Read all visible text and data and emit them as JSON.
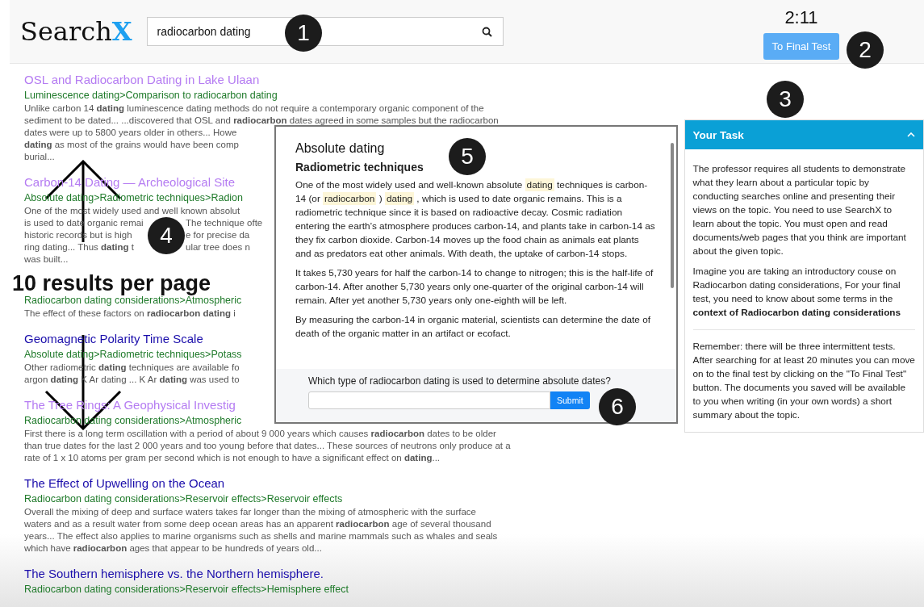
{
  "header": {
    "logo": {
      "text": "Search",
      "accent": "X"
    },
    "search": {
      "value": "radiocarbon dating"
    },
    "timer": "2:11",
    "final_button": "To Final Test"
  },
  "results": [
    {
      "title": "OSL and Radiocarbon Dating in Lake Ulaan",
      "visited": true,
      "breadcrumb": "Luminescence dating>Comparison to radiocarbon dating",
      "lines": [
        [
          "Unlike carbon 14 **dating** luminescence dating methods do not require a contemporary organic component of the"
        ],
        [
          "sediment to be dated... ...discovered that OSL and **radiocarbon** dates agreed in some samples but the radiocarbon"
        ],
        [
          "dates were up to 5800 years older in others... Howe"
        ],
        [
          "**dating** as most of the grains would have been comp"
        ],
        [
          "burial..."
        ]
      ]
    },
    {
      "title": "Carbon-14 Dating — Archeological Site",
      "visited": true,
      "breadcrumb": "Absolute dating>Radiometric techniques>Radion",
      "lines": [
        [
          "One of the most widely used and well known absolut"
        ],
        [
          "is used to date organic remai",
          "The technique ofte"
        ],
        [
          "historic records but is high",
          "e for precise da"
        ],
        [
          "ring dating... Thus **dating** t",
          "ular tree does n"
        ],
        [
          "was built..."
        ]
      ]
    },
    {
      "breadcrumb": "Radiocarbon dating considerations>Atmospheric",
      "lines": [
        [
          "The effect of these factors on **radiocarbon dating** i"
        ]
      ]
    },
    {
      "title": "Geomagnetic Polarity Time Scale",
      "visited": false,
      "breadcrumb": "Absolute dating>Radiometric techniques>Potass",
      "lines": [
        [
          "Other radiometric **dating** techniques are available fo"
        ],
        [
          "argon **dating** K Ar dating ... K Ar **dating** was used to"
        ]
      ]
    },
    {
      "title": "The Tree Rings: A Geophysical Investig",
      "visited": true,
      "breadcrumb": "Radiocarbon dating considerations>Atmospheric",
      "lines": [
        [
          "First there is a long term oscillation with a period of about 9 000 years which causes **radiocarbon** dates to be older"
        ],
        [
          "than true dates for the last 2 000 years and too young before that dates... These sources of neutrons only produce at a"
        ],
        [
          "rate of 1 x 10 atoms per gram per second which is not enough to have a significant effect on **dating**..."
        ]
      ]
    },
    {
      "title": "The Effect of Upwelling on the Ocean",
      "visited": false,
      "breadcrumb": "Radiocarbon dating considerations>Reservoir effects>Reservoir effects",
      "lines": [
        [
          "Overall the mixing of deep and surface waters takes far longer than the mixing of atmospheric with the surface"
        ],
        [
          "waters and as a result water from some deep ocean areas has an apparent **radiocarbon** age of several thousand"
        ],
        [
          "years... The effect also applies to marine organisms such as shells and marine mammals such as whales and seals"
        ],
        [
          "which have **radiocarbon** ages that appear to be hundreds of years old..."
        ]
      ]
    },
    {
      "title": "The Southern hemisphere vs. the Northern hemisphere.",
      "visited": false,
      "breadcrumb": "Radiocarbon dating considerations>Reservoir effects>Hemisphere effect"
    }
  ],
  "document_modal": {
    "title": "Absolute dating",
    "subtitle": "Radiometric techniques",
    "paragraphs": [
      [
        {
          "text": "One of the most widely used and well-known absolute",
          "highlight": false
        },
        {
          "text": "dating",
          "highlight": true
        },
        {
          "text": "techniques is carbon-14 (or",
          "highlight": false
        },
        {
          "text": "radiocarbon",
          "highlight": true
        },
        {
          "text": ")",
          "highlight": false
        },
        {
          "text": "dating",
          "highlight": true
        },
        {
          "text": ", which is used to date organic remains. This is a radiometric technique since it is based on radioactive decay. Cosmic radiation entering the earth’s atmosphere produces carbon-14, and plants take in carbon-14 as they fix carbon dioxide. Carbon-14 moves up the food chain as animals eat plants and as predators eat other animals. With death, the uptake of carbon-14 stops.",
          "highlight": false
        }
      ],
      [
        {
          "text": "It takes 5,730 years for half the carbon-14 to change to nitrogen; this is the half-life of carbon-14. After another 5,730 years only one-quarter of the original carbon-14 will remain. After yet another 5,730 years only one-eighth will be left.",
          "highlight": false
        }
      ],
      [
        {
          "text": "By measuring the carbon-14 in organic material, scientists can determine the date of death of the organic matter in an artifact or ecofact.",
          "highlight": false
        }
      ]
    ],
    "question": "Which type of radiocarbon dating is used to determine absolute dates?",
    "submit": "Submit"
  },
  "task_panel": {
    "title": "Your Task",
    "expanded": true,
    "paragraphs": [
      "The professor requires all students to demonstrate what they learn about a particular topic by conducting searches online and presenting their views on the topic. You need to use SearchX to learn about the topic. You must open and read documents/web pages that you think are important about the given topic.",
      "Imagine you are taking an introductory couse on Radiocarbon dating considerations, For your final test, you need to know about some terms in the **context of Radiocarbon dating considerations**"
    ],
    "reminder": "Remember: there will be three intermittent tests. After searching for at least 20 minutes you can move on to the final test by clicking on the \"To Final Test\" button. The documents you saved will be available to you when writing (in your own words) a short summary about the topic."
  },
  "annotations": {
    "badges": [
      "1",
      "2",
      "3",
      "4",
      "5",
      "6"
    ],
    "note": "10 results per page"
  }
}
